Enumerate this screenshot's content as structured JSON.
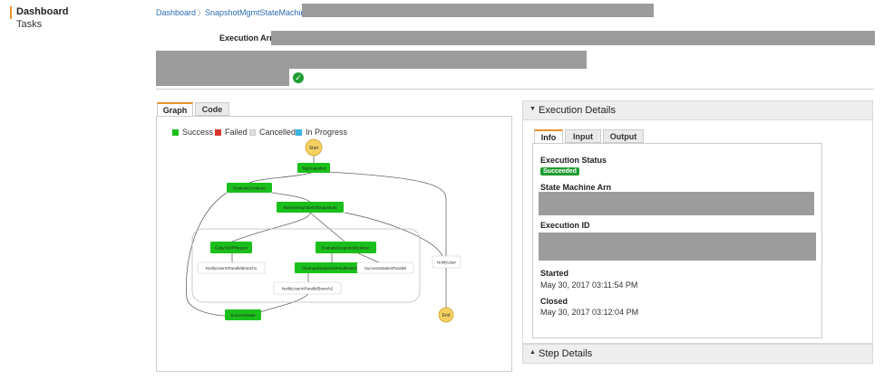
{
  "nav": {
    "dashboard": "Dashboard",
    "tasks": "Tasks"
  },
  "breadcrumb": {
    "root": "Dashboard",
    "separator": "〉",
    "current": "SnapshotMgmtStateMachine-"
  },
  "execution": {
    "arn_label": "Execution Arn:"
  },
  "graph_panel": {
    "tabs": [
      "Graph",
      "Code"
    ],
    "legend": [
      {
        "label": "Success",
        "color": "#1bbf1b"
      },
      {
        "label": "Failed",
        "color": "#d9362b"
      },
      {
        "label": "Cancelled",
        "color": "#dddddd"
      },
      {
        "label": "In Progress",
        "color": "#3cb5e0"
      }
    ],
    "nodes": {
      "start": "Start",
      "tag": "TagSnapshot",
      "evaluate": "EvaluateContinue",
      "retrieve": "RetrieveNumberOfSnapshots",
      "copy": "CopyToDRRegion",
      "eval_deletion": "EvaluateSnapshotDeletion",
      "notify1": "NotifyUserInParallelBranch1",
      "cleanup": "CleanupSnapshotsPastRetention",
      "success_parallel": "SuccessStateInParallel",
      "notify2": "NotifyUserInParallelBranch2",
      "notify_user": "NotifyUser",
      "success_state": "SuccessState",
      "end": "End"
    }
  },
  "details": {
    "header": "Execution Details",
    "tabs": [
      "Info",
      "Input",
      "Output"
    ],
    "status_label": "Execution Status",
    "status_value": "Succeeded",
    "arn_label": "State Machine Arn",
    "id_label": "Execution ID",
    "started_label": "Started",
    "started_value": "May 30, 2017 03:11:54 PM",
    "closed_label": "Closed",
    "closed_value": "May 30, 2017 03:12:04 PM"
  },
  "step_details": {
    "header": "Step Details"
  }
}
